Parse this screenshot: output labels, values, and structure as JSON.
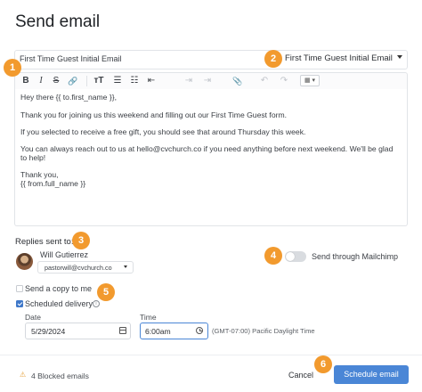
{
  "dialog": {
    "title": "Send email"
  },
  "subject": {
    "value": "First Time Guest Initial Email"
  },
  "template": {
    "selected": "First Time Guest Initial Email"
  },
  "toolbar": {
    "bold": "B",
    "italic": "I",
    "strike": "S",
    "link": "🔗",
    "text_size": "тT",
    "bulleted_list": "☰",
    "numbered_list": "☷",
    "outdent": "⇤",
    "indent": "⇥",
    "attach": "📎",
    "undo": "↶",
    "redo": "↷",
    "table": "▦ ▾"
  },
  "body": {
    "lines": [
      "Hey there {{ to.first_name }},",
      "Thank you for joining us this weekend and filling out our First Time Guest form.",
      "If you selected to receive a free gift, you should see that around Thursday this week.",
      "You can always reach out to us at hello@cvchurch.co if you need anything before next weekend. We'll be glad",
      "to help!",
      "Thank you,",
      "{{ from.full_name }}"
    ]
  },
  "replies": {
    "label": "Replies sent to:",
    "name": "Will Gutierrez",
    "email": "pastorwill@cvchurch.co"
  },
  "mailchimp": {
    "label": "Send through Mailchimp",
    "enabled": false
  },
  "send_copy": {
    "label": "Send a copy to me",
    "checked": false
  },
  "scheduled": {
    "label": "Scheduled delivery",
    "checked": true,
    "info_icon": "i"
  },
  "schedule": {
    "date_label": "Date",
    "date_value": "5/29/2024",
    "time_label": "Time",
    "time_value": "6:00am",
    "timezone": "(GMT-07:00) Pacific Daylight Time"
  },
  "footer": {
    "warning_icon": "⚠",
    "blocked": "4 Blocked emails",
    "cancel": "Cancel",
    "schedule": "Schedule email"
  },
  "callouts": [
    "1",
    "2",
    "3",
    "4",
    "5",
    "6"
  ],
  "colors": {
    "accent": "#4a86d6",
    "callout": "#f29a2e",
    "warning": "#e5a23d"
  }
}
